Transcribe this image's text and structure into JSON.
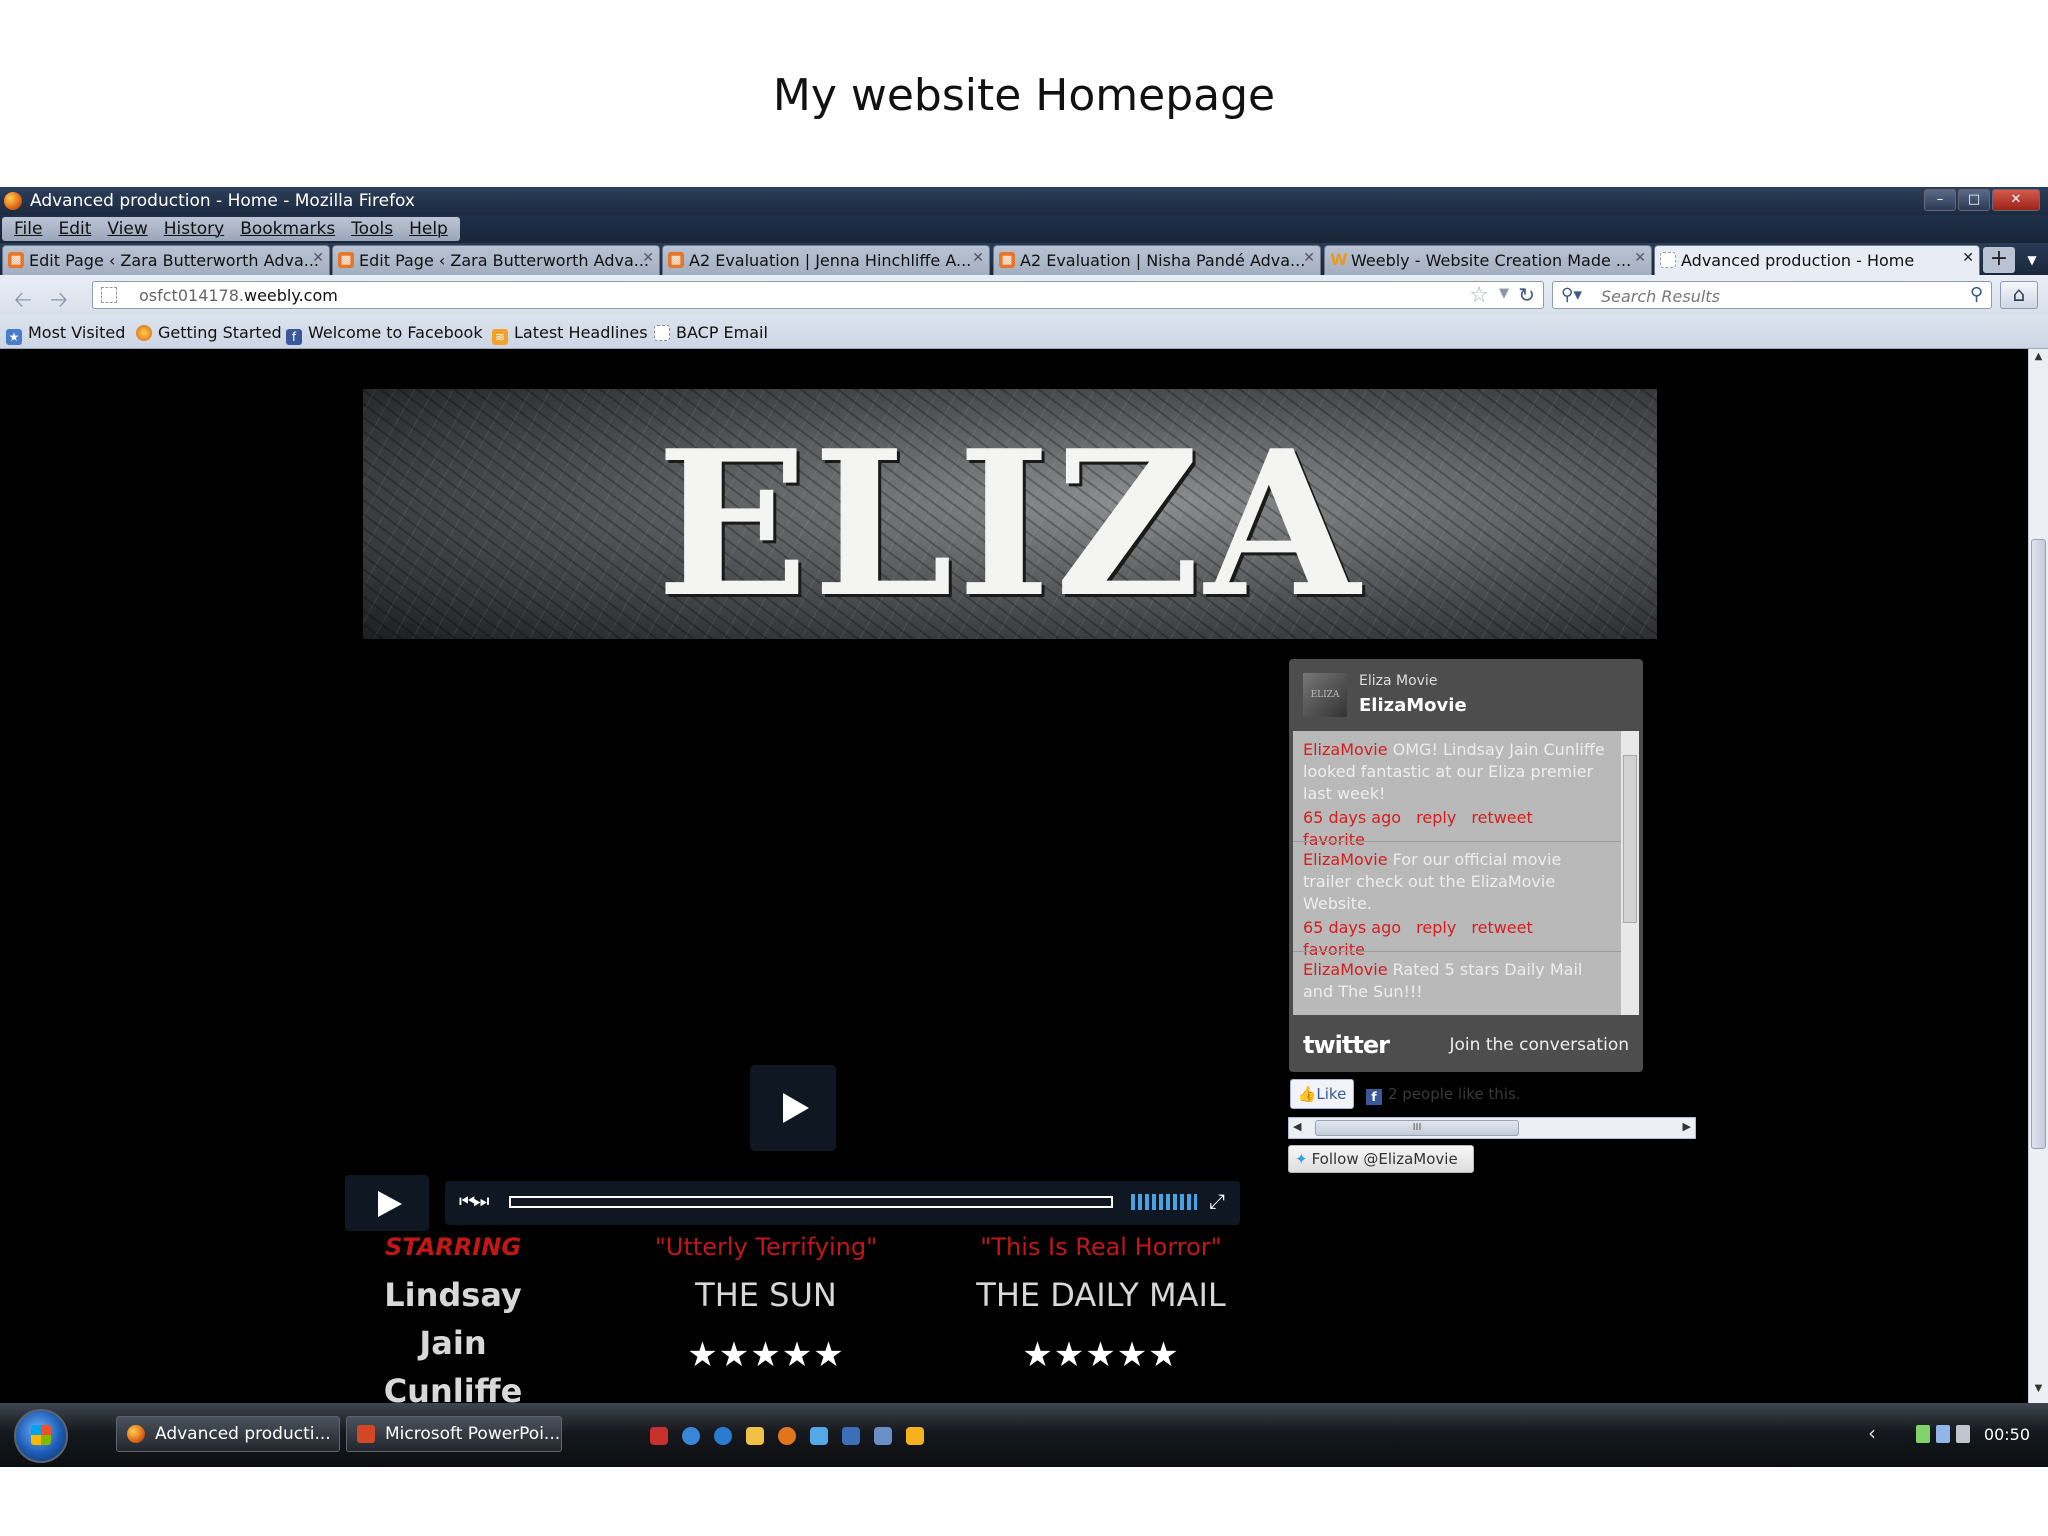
{
  "slide": {
    "title": "My website Homepage"
  },
  "window": {
    "title": "Advanced production - Home - Mozilla Firefox",
    "controls": {
      "minimize": "–",
      "maximize": "□",
      "close": "✕"
    }
  },
  "menu": [
    "File",
    "Edit",
    "View",
    "History",
    "Bookmarks",
    "Tools",
    "Help"
  ],
  "tabs": [
    {
      "label": "Edit Page ‹ Zara Butterworth Adva...",
      "icon": "weebly-editor-icon"
    },
    {
      "label": "Edit Page ‹ Zara Butterworth Adva...",
      "icon": "weebly-editor-icon"
    },
    {
      "label": "A2 Evaluation | Jenna Hinchliffe A...",
      "icon": "weebly-editor-icon"
    },
    {
      "label": "A2 Evaluation | Nisha Pandé Adva...",
      "icon": "weebly-editor-icon"
    },
    {
      "label": "Weebly - Website Creation Made ...",
      "icon": "weebly-w-icon"
    },
    {
      "label": "Advanced production - Home",
      "icon": "blank-page-icon",
      "active": true
    }
  ],
  "nav": {
    "url_prefix": "osfct014178.",
    "url_domain": "weebly.com",
    "search_placeholder": "Search Results"
  },
  "bookmarks": [
    "Most Visited",
    "Getting Started",
    "Welcome to Facebook",
    "Latest Headlines",
    "BACP Email"
  ],
  "page": {
    "banner_title": "ELIZA",
    "twitter": {
      "name": "Eliza Movie",
      "handle": "ElizaMovie",
      "avatar_text": "ELIZA",
      "tweets": [
        {
          "user": "ElizaMovie",
          "text": "OMG! Lindsay Jain Cunliffe looked fantastic at our Eliza premier last week!",
          "time": "65 days ago",
          "actions": [
            "reply",
            "retweet",
            "favorite"
          ]
        },
        {
          "user": "ElizaMovie",
          "text": "For our official movie trailer check out the ElizaMovie Website.",
          "time": "65 days ago",
          "actions": [
            "reply",
            "retweet",
            "favorite"
          ]
        },
        {
          "user": "ElizaMovie",
          "text": "Rated 5 stars Daily Mail and The Sun!!!",
          "time": "",
          "actions": []
        }
      ],
      "logo": "twitter",
      "join": "Join the conversation"
    },
    "like": {
      "button": "Like",
      "text": "2 people like this."
    },
    "hscroll_grip": "III",
    "follow": "Follow @ElizaMovie",
    "columns": [
      {
        "heading": "STARRING",
        "lines": [
          "Lindsay",
          "Jain",
          "Cunliffe"
        ]
      },
      {
        "heading": "\"Utterly Terrifying\"",
        "lines": [
          "THE SUN"
        ],
        "rating": 5,
        "stars": "★★★★★"
      },
      {
        "heading": "\"This Is Real Horror\"",
        "lines": [
          "THE DAILY MAIL"
        ],
        "rating": 5,
        "stars": "★★★★★"
      }
    ]
  },
  "taskbar": {
    "items": [
      "Advanced producti...",
      "Microsoft PowerPoi..."
    ],
    "clock": "00:50"
  },
  "colors": {
    "accent_red": "#c31717",
    "twitter_red": "#d41e1e",
    "titlebar": "#1c2a40"
  }
}
